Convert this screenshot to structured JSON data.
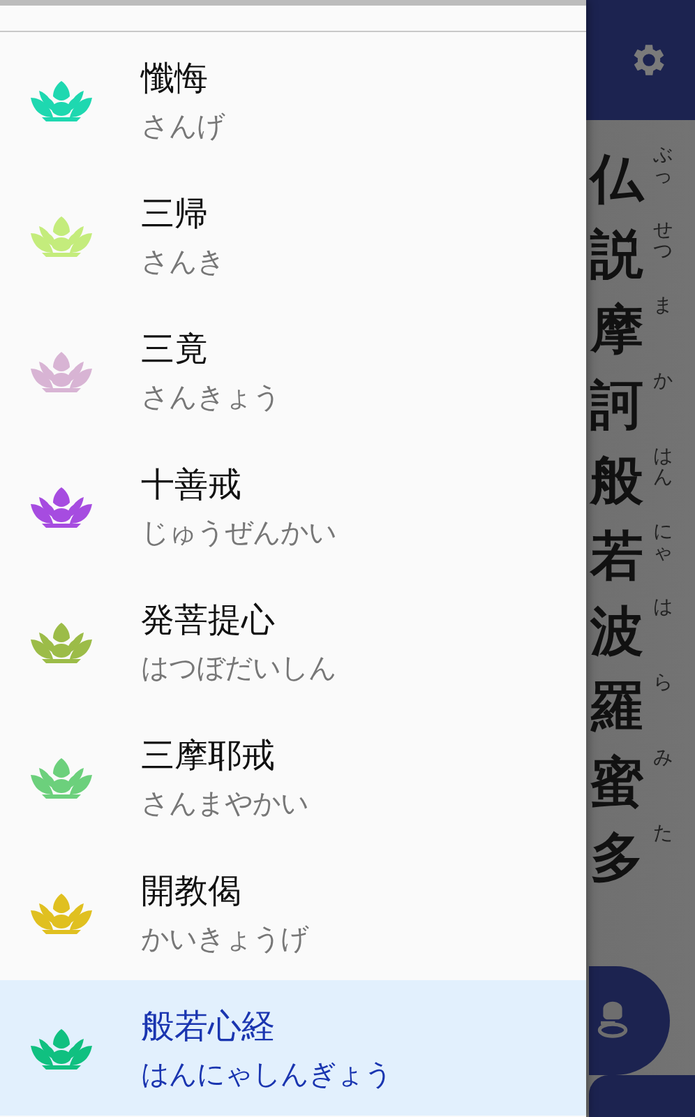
{
  "drawer": {
    "items": [
      {
        "title": "懺悔",
        "reading": "さんげ",
        "color": "#1ed8b0",
        "selected": false
      },
      {
        "title": "三帰",
        "reading": "さんき",
        "color": "#c4ec7c",
        "selected": false
      },
      {
        "title": "三竟",
        "reading": "さんきょう",
        "color": "#d8b4d4",
        "selected": false
      },
      {
        "title": "十善戒",
        "reading": "じゅうぜんかい",
        "color": "#a64ce0",
        "selected": false
      },
      {
        "title": "発菩提心",
        "reading": "はつぼだいしん",
        "color": "#9cbc48",
        "selected": false
      },
      {
        "title": "三摩耶戒",
        "reading": "さんまやかい",
        "color": "#6cd07c",
        "selected": false
      },
      {
        "title": "開教偈",
        "reading": "かいきょうげ",
        "color": "#e0c020",
        "selected": false
      },
      {
        "title": "般若心経",
        "reading": "はんにゃしんぎょう",
        "color": "#10c080",
        "selected": true
      }
    ]
  },
  "sutra": [
    {
      "kanji": "仏",
      "reading": "ぶっ"
    },
    {
      "kanji": "説",
      "reading": "せつ"
    },
    {
      "kanji": "摩",
      "reading": "ま"
    },
    {
      "kanji": "訶",
      "reading": "か"
    },
    {
      "kanji": "般",
      "reading": "はん"
    },
    {
      "kanji": "若",
      "reading": "にゃ"
    },
    {
      "kanji": "波",
      "reading": "は"
    },
    {
      "kanji": "羅",
      "reading": "ら"
    },
    {
      "kanji": "蜜",
      "reading": "み"
    },
    {
      "kanji": "多",
      "reading": "た"
    }
  ]
}
